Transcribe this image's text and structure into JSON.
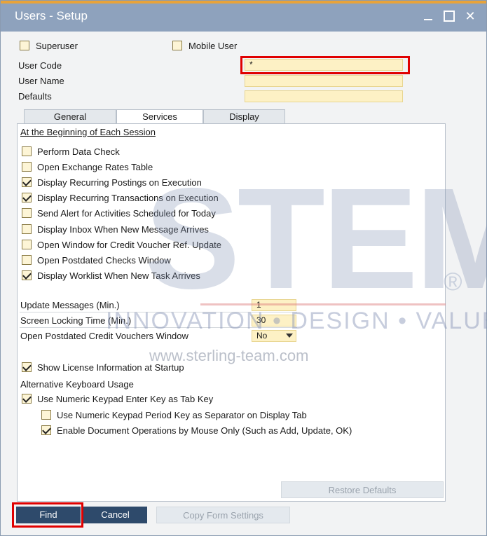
{
  "window": {
    "title": "Users - Setup"
  },
  "top_checks": {
    "superuser": {
      "label": "Superuser",
      "checked": false
    },
    "mobile_user": {
      "label": "Mobile User",
      "checked": false
    }
  },
  "fields": {
    "user_code": {
      "label": "User Code",
      "value": "*"
    },
    "user_name": {
      "label": "User Name",
      "value": ""
    },
    "defaults": {
      "label": "Defaults",
      "value": ""
    }
  },
  "tabs": [
    "General",
    "Services",
    "Display"
  ],
  "active_tab": "Services",
  "services": {
    "section_title": "At the Beginning of Each Session",
    "items": [
      {
        "label": "Perform Data Check",
        "checked": false
      },
      {
        "label": "Open Exchange Rates Table",
        "checked": false
      },
      {
        "label": "Display Recurring Postings on Execution",
        "checked": true
      },
      {
        "label": "Display Recurring Transactions on Execution",
        "checked": true
      },
      {
        "label": "Send Alert for Activities Scheduled for Today",
        "checked": false
      },
      {
        "label": "Display Inbox When New Message Arrives",
        "checked": false
      },
      {
        "label": "Open Window for Credit Voucher Ref. Update",
        "checked": false
      },
      {
        "label": "Open Postdated Checks Window",
        "checked": false
      },
      {
        "label": "Display Worklist When New Task Arrives",
        "checked": true
      }
    ],
    "update_messages": {
      "label": "Update Messages (Min.)",
      "value": "1"
    },
    "screen_locking": {
      "label": "Screen Locking Time (Min.)",
      "value": "30"
    },
    "postdated_credit": {
      "label": "Open Postdated Credit Vouchers Window",
      "value": "No"
    },
    "show_license": {
      "label": "Show License Information at Startup",
      "checked": true
    },
    "alt_keyboard_title": "Alternative Keyboard Usage",
    "use_numeric_enter": {
      "label": "Use Numeric Keypad Enter Key as Tab Key",
      "checked": true
    },
    "use_numeric_period": {
      "label": "Use Numeric Keypad Period Key as Separator on Display Tab",
      "checked": false
    },
    "enable_mouse_only": {
      "label": "Enable Document Operations by Mouse Only (Such as Add, Update, OK)",
      "checked": true
    },
    "restore_defaults": "Restore Defaults"
  },
  "buttons": {
    "find": "Find",
    "cancel": "Cancel",
    "copy_form": "Copy Form Settings"
  },
  "watermark": {
    "logo": "STEM",
    "registered": "®",
    "tagline": "INNOVATION • DESIGN • VALUE",
    "url": "www.sterling-team.com"
  },
  "colors": {
    "titlebar": "#8ea2bd",
    "field": "#fdf1c5",
    "highlight": "#e00000",
    "button": "#2e4a6b"
  }
}
